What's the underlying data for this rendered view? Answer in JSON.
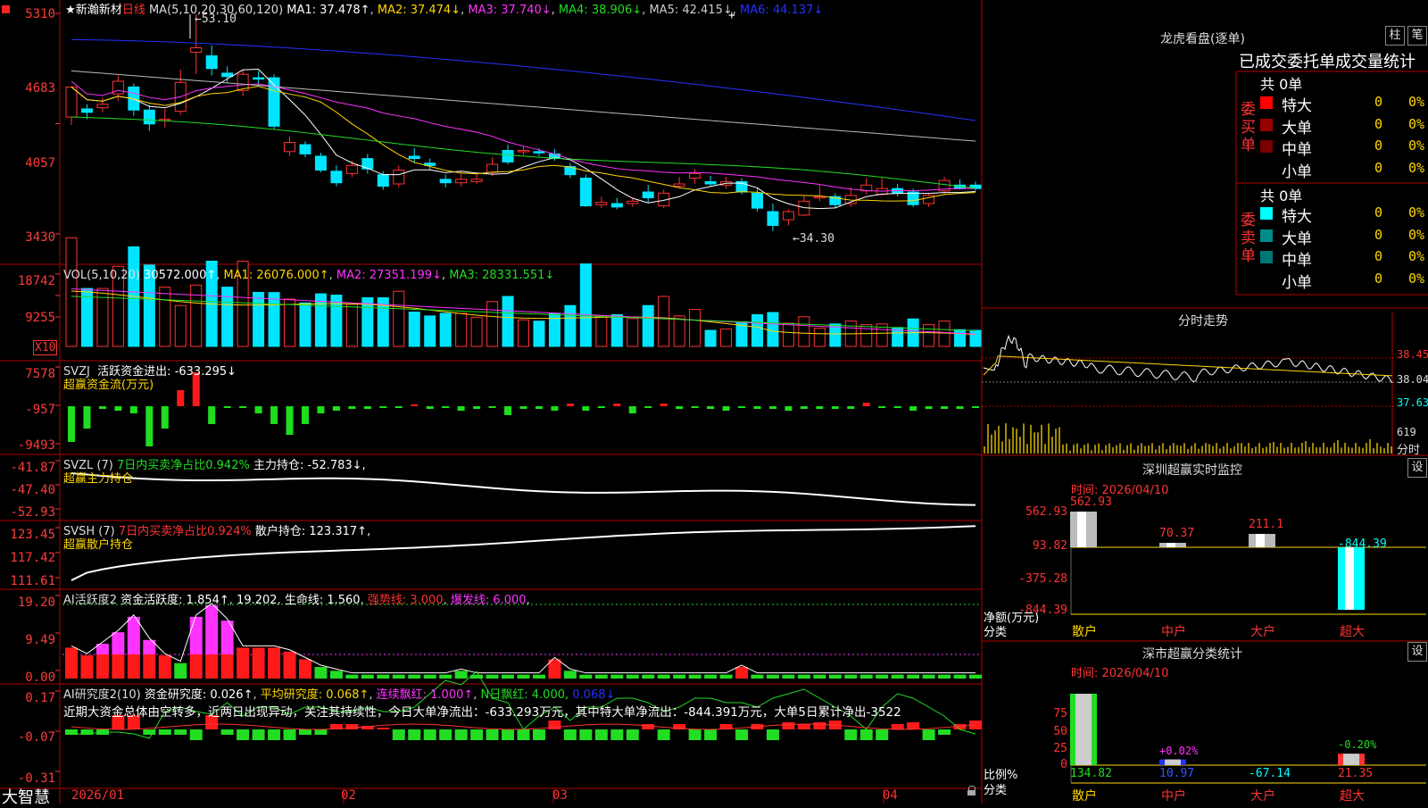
{
  "colors": {
    "up": "#ff3333",
    "down": "#00e5ff",
    "frame": "#b00000",
    "yellow": "#ffd700",
    "magenta": "#ff33ff",
    "green": "#22dd22",
    "blue": "#2222ff",
    "white": "#ffffff"
  },
  "kline": {
    "star": "★",
    "stock": "新瀚新材",
    "period": "日线",
    "ma_title": "MA(5,10,20,30,60,120)",
    "ma1": "MA1: 37.478↑",
    "ma2": "MA2: 37.474↓",
    "ma3": "MA3: 37.740↓",
    "ma4": "MA4: 38.906↓",
    "ma5": "MA5: 42.415↓",
    "ma6": "MA6: 44.137↓",
    "y_ticks": [
      "5310",
      "4683",
      "4057",
      "3430"
    ],
    "high_label": "53.10",
    "low_label": "←34.30",
    "date_labels": [
      "2026/01",
      "02",
      "03",
      "04"
    ],
    "candles": [
      [
        44.2,
        46.8,
        46.4,
        43.5
      ],
      [
        44.9,
        44.6,
        45.3,
        44.0
      ],
      [
        45.0,
        45.3,
        45.9,
        44.6
      ],
      [
        46.2,
        47.3,
        47.8,
        45.6
      ],
      [
        46.8,
        44.8,
        47.1,
        44.3
      ],
      [
        44.8,
        43.6,
        45.2,
        43.0
      ],
      [
        43.9,
        44.0,
        44.9,
        43.3
      ],
      [
        44.7,
        47.2,
        48.3,
        44.4
      ],
      [
        49.8,
        50.2,
        53.1,
        47.9
      ],
      [
        49.5,
        48.4,
        50.4,
        47.8
      ],
      [
        48.0,
        47.7,
        48.6,
        47.2
      ],
      [
        46.5,
        47.9,
        48.3,
        46.0
      ],
      [
        47.6,
        47.5,
        48.2,
        47.0
      ],
      [
        47.6,
        43.4,
        47.9,
        43.1
      ],
      [
        41.2,
        42.0,
        42.5,
        40.8
      ],
      [
        41.8,
        41.0,
        42.1,
        40.7
      ],
      [
        40.8,
        39.6,
        41.1,
        39.4
      ],
      [
        39.5,
        38.5,
        40.0,
        38.2
      ],
      [
        39.3,
        40.0,
        40.4,
        39.0
      ],
      [
        40.6,
        39.7,
        41.0,
        39.3
      ],
      [
        39.2,
        38.2,
        39.5,
        37.9
      ],
      [
        38.4,
        39.6,
        40.0,
        38.1
      ],
      [
        40.8,
        40.6,
        41.5,
        40.2
      ],
      [
        40.2,
        40.0,
        40.6,
        39.6
      ],
      [
        38.8,
        38.5,
        39.2,
        38.1
      ],
      [
        38.5,
        38.8,
        39.3,
        38.2
      ],
      [
        38.6,
        38.8,
        39.3,
        38.4
      ],
      [
        39.4,
        40.1,
        40.7,
        39.1
      ],
      [
        41.3,
        40.3,
        41.8,
        40.1
      ],
      [
        41.2,
        41.3,
        41.7,
        40.9
      ],
      [
        41.2,
        41.1,
        41.5,
        40.8
      ],
      [
        41.0,
        40.6,
        41.4,
        40.4
      ],
      [
        39.9,
        39.2,
        40.2,
        38.9
      ],
      [
        38.9,
        36.5,
        39.2,
        36.4
      ],
      [
        36.6,
        36.8,
        37.3,
        36.3
      ],
      [
        36.7,
        36.4,
        37.2,
        36.2
      ],
      [
        36.7,
        36.9,
        37.2,
        36.4
      ],
      [
        37.7,
        37.2,
        38.3,
        36.8
      ],
      [
        36.5,
        37.6,
        37.9,
        36.3
      ],
      [
        38.2,
        38.4,
        39.0,
        38.0
      ],
      [
        38.9,
        39.3,
        39.7,
        38.4
      ],
      [
        38.6,
        38.4,
        39.1,
        38.2
      ],
      [
        38.3,
        38.6,
        39.0,
        38.0
      ],
      [
        38.6,
        37.7,
        38.9,
        37.5
      ],
      [
        37.6,
        36.3,
        38.0,
        36.0
      ],
      [
        36.0,
        34.8,
        36.7,
        34.3
      ],
      [
        35.3,
        36.0,
        36.2,
        34.8
      ],
      [
        35.7,
        36.9,
        37.4,
        35.6
      ],
      [
        37.3,
        37.3,
        38.3,
        36.9
      ],
      [
        37.3,
        36.6,
        37.6,
        36.3
      ],
      [
        36.7,
        37.4,
        38.1,
        36.4
      ],
      [
        37.8,
        38.3,
        38.9,
        37.5
      ],
      [
        37.5,
        38.0,
        38.9,
        37.4
      ],
      [
        38.0,
        37.6,
        38.4,
        37.3
      ],
      [
        37.7,
        36.6,
        38.0,
        36.4
      ],
      [
        36.7,
        37.4,
        37.6,
        36.4
      ],
      [
        37.8,
        38.7,
        39.0,
        37.5
      ],
      [
        38.3,
        38.0,
        38.8,
        37.9
      ],
      [
        38.3,
        38.0,
        38.6,
        37.8
      ]
    ]
  },
  "vol": {
    "title": "VOL(5,10,20)",
    "value": "30572.000↑",
    "ma1": "MA1: 26076.000↑",
    "ma2": "MA2: 27351.199↓",
    "ma3": "MA3: 28331.551↓",
    "y_ticks": [
      "18742",
      "9255"
    ],
    "unit": "X10"
  },
  "svzj": {
    "title": "SVZJ",
    "label": "活跃资金进出:",
    "value": "-633.295↓",
    "sub": "超赢资金流(万元)",
    "y_ticks": [
      "7578",
      "-957",
      "-9493"
    ]
  },
  "svzl": {
    "title": "SVZL (7)",
    "desc": "7日内买卖净占比0.942%",
    "label": "主力持仓:",
    "value": "-52.783↓,",
    "sub": "超赢主力持仓",
    "y_ticks": [
      "-41.87",
      "-47.40",
      "-52.93"
    ]
  },
  "svsh": {
    "title": "SVSH (7)",
    "desc": "7日内买卖净占比0.924%",
    "label": "散户持仓:",
    "value": "123.317↑,",
    "sub": "超赢散户持仓",
    "y_ticks": [
      "123.45",
      "117.42",
      "111.61"
    ]
  },
  "ai_act": {
    "title": "AI活跃度2",
    "l1": "资金活跃度:",
    "v1": "1.854↑",
    "v2": "19.202",
    "l3": "生命线:",
    "v3": "1.560",
    "l4": "强势线: 3.000",
    "l5": "爆发线: 6.000",
    "y_ticks": [
      "19.20",
      "9.49",
      "0.00"
    ]
  },
  "ai_res": {
    "title": "AI研究度2(10)",
    "l1": "资金研究度:",
    "v1": "0.026↑",
    "l2": "平均研究度:",
    "v2": "0.068↑",
    "l3": "连续飘红: 1.000↑",
    "l4": "N日飘红: 4.000,",
    "l5": "0.068↓",
    "note": "近期大资金总体由空转多，近两日出现异动，关注其持续性，今日大单净流出：-633.293万元，其中特大单净流出：-844.391万元，大单5日累计净出-3522",
    "y_ticks": [
      "0.17",
      "-0.07",
      "-0.31"
    ]
  },
  "footer": {
    "logo": "大智慧"
  },
  "right": {
    "lhb_title": "龙虎看盘(逐单)",
    "btn_zhu": "柱",
    "btn_pen": "笔",
    "tabs": "已成交委托单成交量统计",
    "buy_side": {
      "label": "委买单",
      "total": "共 0单",
      "rows": [
        {
          "name": "特大",
          "v": "0",
          "p": "0%",
          "c": "#ff0000"
        },
        {
          "name": "大单",
          "v": "0",
          "p": "0%",
          "c": "#990000"
        },
        {
          "name": "中单",
          "v": "0",
          "p": "0%",
          "c": "#770000"
        },
        {
          "name": "小单",
          "v": "0",
          "p": "0%",
          "c": "#000000"
        }
      ]
    },
    "sell_side": {
      "label": "委卖单",
      "total": "共 0单",
      "rows": [
        {
          "name": "特大",
          "v": "0",
          "p": "0%",
          "c": "#00ffff"
        },
        {
          "name": "大单",
          "v": "0",
          "p": "0%",
          "c": "#008b8b"
        },
        {
          "name": "中单",
          "v": "0",
          "p": "0%",
          "c": "#007777"
        },
        {
          "name": "小单",
          "v": "0",
          "p": "0%",
          "c": "#000000"
        }
      ]
    },
    "fs_title": "分时走势",
    "fs_ticks": [
      "38.45",
      "38.04",
      "37.63",
      "619"
    ],
    "fs_unit": "分时",
    "sz_title": "深圳超赢实时监控",
    "sz_time": "时间: 2026/04/10",
    "sz_ticks": [
      "562.93",
      "93.82",
      "-375.28",
      "-844.39"
    ],
    "sz_bars": [
      {
        "cat": "散户",
        "val": 562.93,
        "label": "562.93"
      },
      {
        "cat": "中户",
        "val": 70.37,
        "label": "70.37"
      },
      {
        "cat": "大户",
        "val": 211.1,
        "label": "211.1"
      },
      {
        "cat": "超大",
        "val": -844.39,
        "label": "-844.39"
      }
    ],
    "sz_ylabel1": "净额(万元)",
    "sz_ylabel2": "分类",
    "set_btn": "设",
    "sh_title": "深市超赢分类统计",
    "sh_time": "时间: 2026/04/10",
    "sh_ticks": [
      "75",
      "50",
      "25",
      "0"
    ],
    "sh_bars": [
      {
        "cat": "散户",
        "pct": "",
        "val": "134.82",
        "ratio": 100
      },
      {
        "cat": "中户",
        "pct": "+0.02%",
        "val": "10.97",
        "ratio": 8
      },
      {
        "cat": "大户",
        "pct": "",
        "val": "-67.14",
        "ratio": 0
      },
      {
        "cat": "超大",
        "pct": "-0.20%",
        "val": "21.35",
        "ratio": 16
      }
    ],
    "sh_ylabel1": "比例%",
    "sh_ylabel2": "分类"
  }
}
